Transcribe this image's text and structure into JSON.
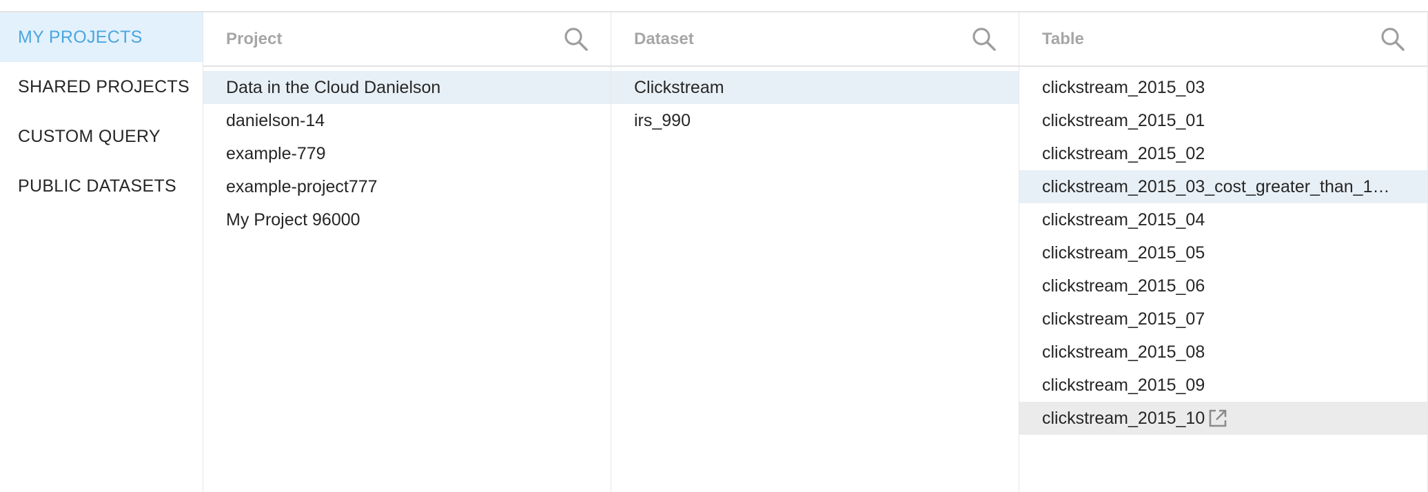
{
  "sidebar": {
    "items": [
      {
        "label": "MY PROJECTS"
      },
      {
        "label": "SHARED PROJECTS"
      },
      {
        "label": "CUSTOM QUERY"
      },
      {
        "label": "PUBLIC DATASETS"
      }
    ],
    "active_index": 0
  },
  "columns": {
    "project": {
      "title": "Project",
      "search_icon": "search-icon",
      "items": [
        "Data in the Cloud Danielson",
        "danielson-14",
        "example-779",
        "example-project777",
        "My Project 96000"
      ],
      "selected_index": 0
    },
    "dataset": {
      "title": "Dataset",
      "search_icon": "search-icon",
      "items": [
        "Clickstream",
        "irs_990"
      ],
      "selected_index": 0
    },
    "table": {
      "title": "Table",
      "search_icon": "search-icon",
      "items": [
        "clickstream_2015_03",
        "clickstream_2015_01",
        "clickstream_2015_02",
        "clickstream_2015_03_cost_greater_than_1…",
        "clickstream_2015_04",
        "clickstream_2015_05",
        "clickstream_2015_06",
        "clickstream_2015_07",
        "clickstream_2015_08",
        "clickstream_2015_09",
        "clickstream_2015_10"
      ],
      "selected_index": 3,
      "hovered_index": 10,
      "hover_icon": "open-in-new-icon"
    }
  },
  "colors": {
    "accent": "#4aa6de",
    "active_nav_bg": "#e3f1fc",
    "selected_row_bg": "#e8f0f7",
    "hovered_row_bg": "#ebebeb",
    "header_text": "#a6a6a6",
    "body_text": "#262626"
  }
}
